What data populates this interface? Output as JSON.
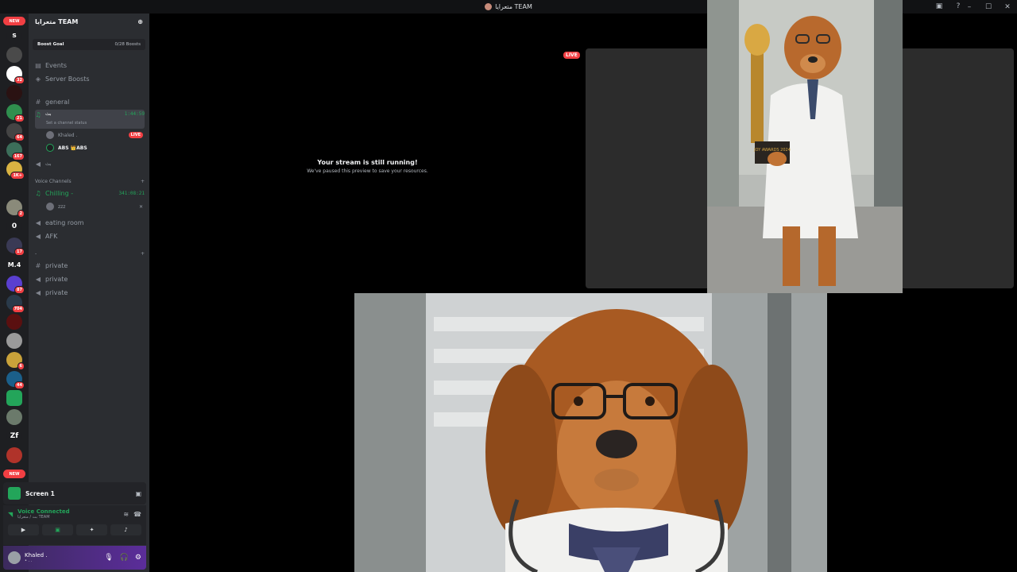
{
  "window": {
    "title": "متعرايا TEAM",
    "controls": [
      "–",
      "☐",
      "✕"
    ]
  },
  "rail": {
    "new_label_top": "NEW",
    "new_label_bottom": "NEW",
    "items": [
      {
        "label": "s"
      },
      {
        "label": ""
      },
      {
        "label": "",
        "badge": "32"
      },
      {
        "label": ""
      },
      {
        "label": "",
        "badge": "21"
      },
      {
        "label": "",
        "badge": "64"
      },
      {
        "label": "",
        "badge": "167"
      },
      {
        "label": "",
        "badge": "1K+"
      },
      {
        "label": ""
      },
      {
        "label": "",
        "badge": "2"
      },
      {
        "label": "0"
      },
      {
        "label": "",
        "badge": "17"
      },
      {
        "label": "M.4"
      },
      {
        "label": "",
        "badge": "87"
      },
      {
        "label": "",
        "badge": "704"
      },
      {
        "label": ""
      },
      {
        "label": ""
      },
      {
        "label": "",
        "badge": "6"
      },
      {
        "label": "",
        "badge": "44"
      },
      {
        "label": ""
      },
      {
        "label": ""
      },
      {
        "label": "Zf"
      },
      {
        "label": ""
      }
    ]
  },
  "sidebar": {
    "server_name": "متعرايا TEAM",
    "boost_goal": "Boost Goal",
    "boost_count": "0/28 Boosts",
    "events": "Events",
    "server_boosts": "Server Boosts",
    "general": "general",
    "active_voice": "بث",
    "active_timer": "1:44:59",
    "set_status": "Set a channel status",
    "user1": "Khaled .",
    "user1_live": "LIVE",
    "user2": "ABS 👑ABS",
    "voice2": "بث",
    "voice_category": "Voice Channels",
    "chilling": "Chilling -",
    "chilling_timer": "341:08:21",
    "zzz_user": "zzz",
    "eating_room": "eating room",
    "afk": "AFK",
    "category3": "-",
    "private1": "private",
    "private2": "private",
    "private3": "private"
  },
  "bottom": {
    "screen_label": "Screen 1",
    "voice_connected": "Voice Connected",
    "voice_sub": "بث / متعرايا TEAM",
    "username": "Khaled .",
    "user_status": "• . ."
  },
  "stage": {
    "paused_title": "Your stream is still running!",
    "paused_sub": "We've paused this preview to save your resources.",
    "live_tag": "LIVE"
  },
  "photo_caption": "JOY AWARDS 2024"
}
